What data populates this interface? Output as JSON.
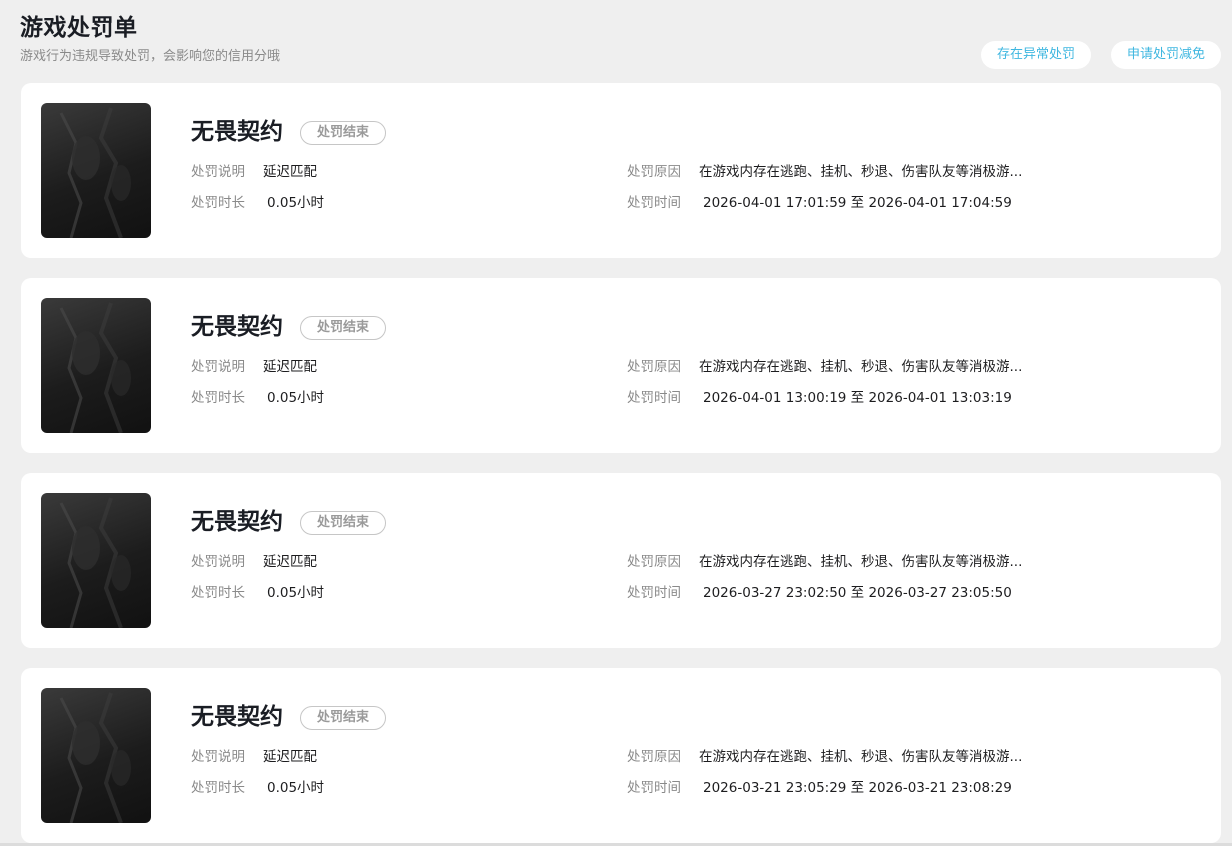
{
  "header": {
    "title": "游戏处罚单",
    "subtitle": "游戏行为违规导致处罚，会影响您的信用分哦",
    "abnormal_button": "存在异常处罚",
    "reduce_button": "申请处罚减免"
  },
  "labels": {
    "desc": "处罚说明",
    "duration": "处罚时长",
    "reason": "处罚原因",
    "time": "处罚时间"
  },
  "records": [
    {
      "game": "无畏契约",
      "status": "处罚结束",
      "desc": "延迟匹配",
      "duration": "0.05小时",
      "reason": "在游戏内存在逃跑、挂机、秒退、伤害队友等消极游...",
      "time": "2026-04-01 17:01:59 至 2026-04-01 17:04:59"
    },
    {
      "game": "无畏契约",
      "status": "处罚结束",
      "desc": "延迟匹配",
      "duration": "0.05小时",
      "reason": "在游戏内存在逃跑、挂机、秒退、伤害队友等消极游...",
      "time": "2026-04-01 13:00:19 至 2026-04-01 13:03:19"
    },
    {
      "game": "无畏契约",
      "status": "处罚结束",
      "desc": "延迟匹配",
      "duration": "0.05小时",
      "reason": "在游戏内存在逃跑、挂机、秒退、伤害队友等消极游...",
      "time": "2026-03-27 23:02:50 至 2026-03-27 23:05:50"
    },
    {
      "game": "无畏契约",
      "status": "处罚结束",
      "desc": "延迟匹配",
      "duration": "0.05小时",
      "reason": "在游戏内存在逃跑、挂机、秒退、伤害队友等消极游...",
      "time": "2026-03-21 23:05:29 至 2026-03-21 23:08:29"
    }
  ]
}
